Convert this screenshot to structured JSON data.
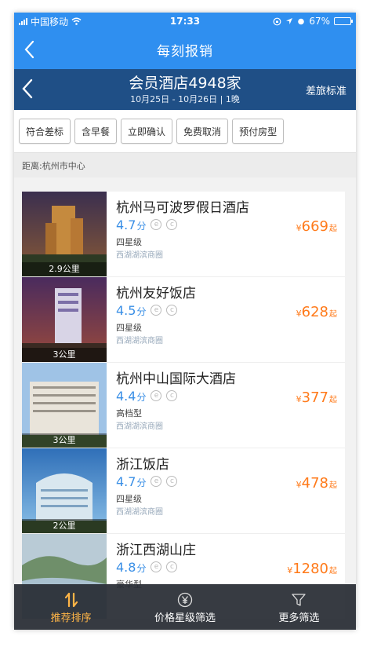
{
  "status_bar": {
    "carrier": "中国移动",
    "time": "17:33",
    "battery": "67%",
    "battery_level": 0.67
  },
  "nav": {
    "title": "每刻报销"
  },
  "search": {
    "title": "会员酒店4948家",
    "dates": "10月25日 - 10月26日 | 1晚",
    "policy_link": "差旅标准"
  },
  "filters": [
    "符合差标",
    "含早餐",
    "立即确认",
    "免费取消",
    "预付房型"
  ],
  "distance_label": "距离:杭州市中心",
  "hotels": [
    {
      "name": "杭州马可波罗假日酒店",
      "score": "4.7",
      "score_unit": "分",
      "star": "四星级",
      "area": "西湖湖滨商圈",
      "price_currency": "¥",
      "price": "669",
      "price_suffix": "起",
      "distance": "2.9公里"
    },
    {
      "name": "杭州友好饭店",
      "score": "4.5",
      "score_unit": "分",
      "star": "四星级",
      "area": "西湖湖滨商圈",
      "price_currency": "¥",
      "price": "628",
      "price_suffix": "起",
      "distance": "3公里"
    },
    {
      "name": "杭州中山国际大酒店",
      "score": "4.4",
      "score_unit": "分",
      "star": "高档型",
      "area": "西湖湖滨商圈",
      "price_currency": "¥",
      "price": "377",
      "price_suffix": "起",
      "distance": "3公里"
    },
    {
      "name": "浙江饭店",
      "score": "4.7",
      "score_unit": "分",
      "star": "四星级",
      "area": "西湖湖滨商圈",
      "price_currency": "¥",
      "price": "478",
      "price_suffix": "起",
      "distance": "2公里"
    },
    {
      "name": "浙江西湖山庄",
      "score": "4.8",
      "score_unit": "分",
      "star": "豪华型",
      "area": "",
      "price_currency": "¥",
      "price": "1280",
      "price_suffix": "起",
      "distance": ""
    }
  ],
  "bottom_bar": {
    "tabs": [
      {
        "label": "推荐排序",
        "icon": "sort-icon"
      },
      {
        "label": "价格星级筛选",
        "icon": "yuan-icon"
      },
      {
        "label": "更多筛选",
        "icon": "filter-icon"
      }
    ]
  },
  "colors": {
    "primary_blue": "#2f8ff0",
    "header_navy": "#1f4f86",
    "price_orange": "#ff7a1a",
    "score_blue": "#3a8fe6",
    "active_tab": "#ffb547"
  }
}
